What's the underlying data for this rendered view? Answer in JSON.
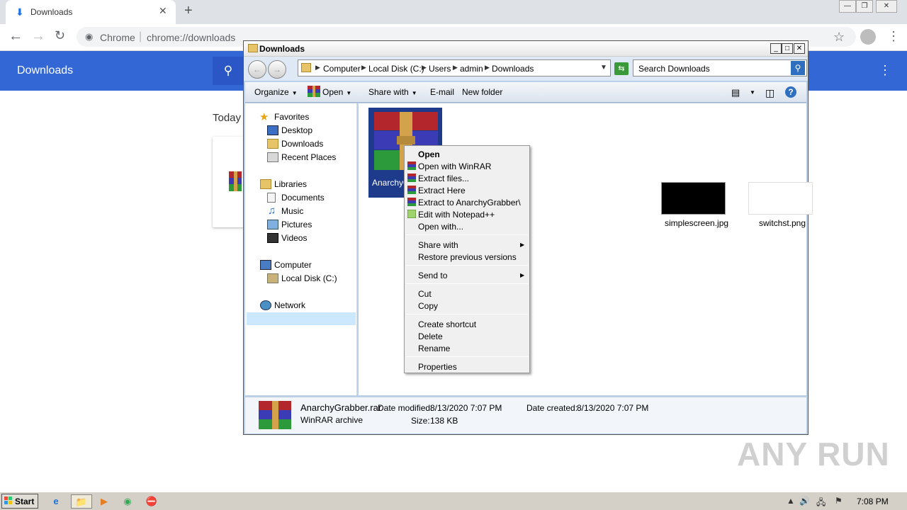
{
  "browser": {
    "tab_title": "Downloads",
    "url_scheme": "Chrome",
    "url": "chrome://downloads",
    "icons": [
      "download-icon",
      "close-icon",
      "plus-icon",
      "back-icon",
      "forward-icon",
      "reload-icon",
      "star-icon",
      "profile-icon",
      "menu-icon"
    ]
  },
  "downloads_page": {
    "header_title": "Downloads",
    "today_label": "Today"
  },
  "explorer": {
    "title": "Downloads",
    "breadcrumbs": [
      "Computer",
      "Local Disk (C:)",
      "Users",
      "admin",
      "Downloads"
    ],
    "search_placeholder": "Search Downloads",
    "toolbar": {
      "organize": "Organize",
      "open": "Open",
      "share_with": "Share with",
      "email": "E-mail",
      "new_folder": "New folder"
    },
    "nav": {
      "favorites": "Favorites",
      "desktop": "Desktop",
      "downloads": "Downloads",
      "recent_places": "Recent Places",
      "libraries": "Libraries",
      "documents": "Documents",
      "music": "Music",
      "pictures": "Pictures",
      "videos": "Videos",
      "computer": "Computer",
      "local_disk": "Local Disk (C:)",
      "network": "Network"
    },
    "files": {
      "archive_label": "AnarchyG",
      "file2": "simplescreen.jpg",
      "file3": "switchst.png"
    },
    "context_menu": {
      "open": "Open",
      "open_with_winrar": "Open with WinRAR",
      "extract_files": "Extract files...",
      "extract_here": "Extract Here",
      "extract_to": "Extract to AnarchyGrabber\\",
      "edit_notepad": "Edit with Notepad++",
      "open_with": "Open with...",
      "share_with": "Share with",
      "restore_versions": "Restore previous versions",
      "send_to": "Send to",
      "cut": "Cut",
      "copy": "Copy",
      "create_shortcut": "Create shortcut",
      "delete": "Delete",
      "rename": "Rename",
      "properties": "Properties"
    },
    "details": {
      "filename": "AnarchyGrabber.rar",
      "filetype": "WinRAR archive",
      "date_modified_label": "Date modified:",
      "date_modified": "8/13/2020 7:07 PM",
      "size_label": "Size:",
      "size": "138 KB",
      "date_created_label": "Date created:",
      "date_created": "8/13/2020 7:07 PM"
    }
  },
  "taskbar": {
    "start_label": "Start",
    "clock": "7:08 PM"
  },
  "watermark": "ANY RUN",
  "colors": {
    "chrome_header": "#3367d6",
    "selection": "#1e3a8a"
  }
}
